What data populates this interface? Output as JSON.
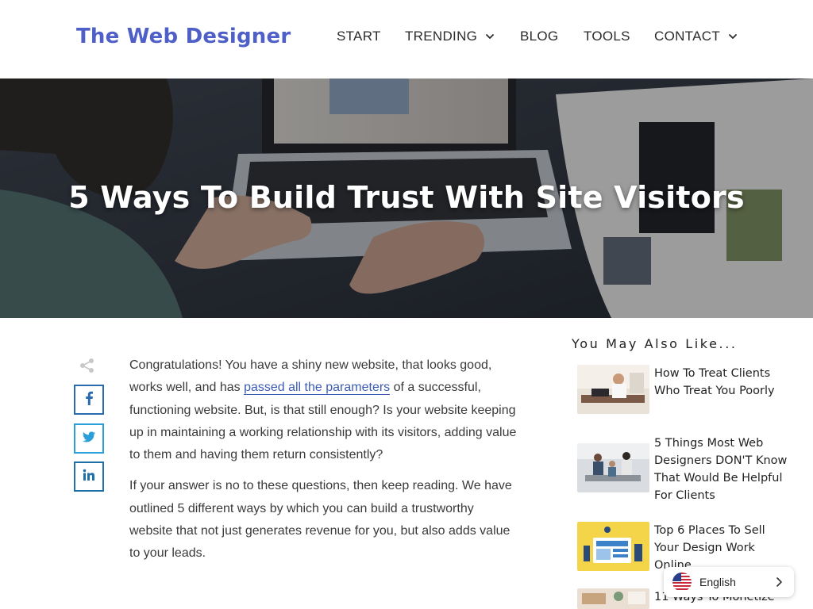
{
  "header": {
    "logo": "The Web Designer",
    "nav": [
      {
        "label": "START",
        "has_dropdown": false
      },
      {
        "label": "TRENDING",
        "has_dropdown": true
      },
      {
        "label": "BLOG",
        "has_dropdown": false
      },
      {
        "label": "TOOLS",
        "has_dropdown": false
      },
      {
        "label": "CONTACT",
        "has_dropdown": true
      }
    ]
  },
  "hero": {
    "title": "5 Ways To Build Trust With Site Visitors",
    "image": "person typing on laptop with magazine on desk"
  },
  "share": {
    "share_icon": "share-icon",
    "buttons": [
      {
        "network": "facebook",
        "glyph": "f",
        "color": "#2a6ab0"
      },
      {
        "network": "twitter",
        "glyph": "twitter-bird",
        "color": "#2b9fd9"
      },
      {
        "network": "linkedin",
        "glyph": "in",
        "color": "#1f6fa8"
      }
    ]
  },
  "article": {
    "p1_before_link": "Congratulations! You have a shiny new website, that looks good, works well, and has ",
    "p1_link": "passed all the parameters",
    "p1_after_link": " of a successful, functioning website. But, is that still enough? Is your website keeping up in maintaining a working relationship with its visitors, adding value to them and having them return consistently?",
    "p2": "If your answer is no to these questions, then keep reading. We have outlined 5 different ways by which you can build a trustworthy website that not just generates revenue for you, but also adds value to your leads."
  },
  "sidebar": {
    "heading": "You May Also Like...",
    "items": [
      {
        "title": "How To Treat Clients Who Treat You Poorly"
      },
      {
        "title": "5 Things Most Web Designers DON'T Know That Would Be Helpful For Clients"
      },
      {
        "title": "Top 6 Places To Sell Your Design Work Online"
      },
      {
        "title": "11 Ways To Monetize"
      }
    ]
  },
  "language": {
    "label": "English",
    "flag": "us-flag-icon"
  },
  "colors": {
    "brand": "#4f5fc8",
    "link": "#3b5bb5",
    "facebook": "#2a6ab0",
    "twitter": "#2b9fd9",
    "linkedin": "#1f6fa8"
  }
}
